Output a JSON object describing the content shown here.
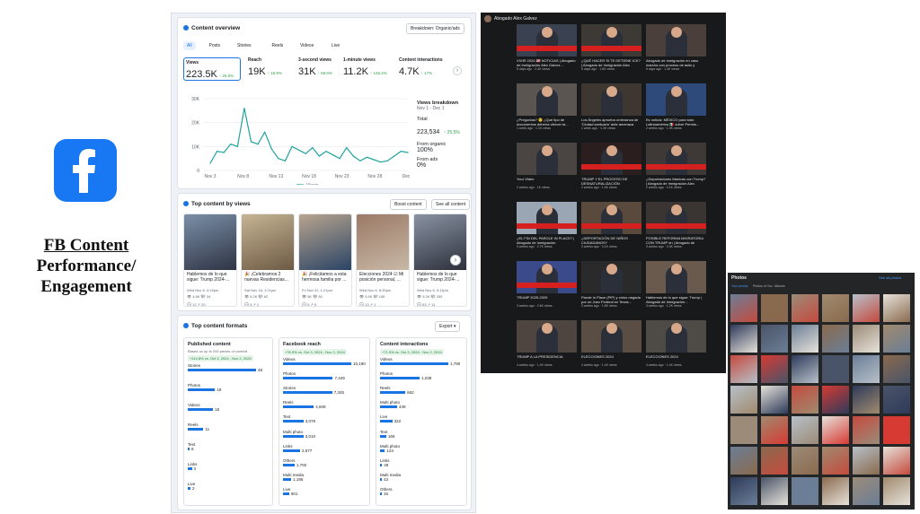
{
  "brand": {
    "title_line1": "FB Content",
    "title_line2": "Performance/",
    "title_line3": "Engagement",
    "accent": "#1877f2"
  },
  "overview": {
    "title": "Content overview",
    "breakdown_select": "Breakdown: Organic/ads",
    "tabs": [
      "All",
      "Posts",
      "Stories",
      "Reels",
      "Videos",
      "Live"
    ],
    "metrics": [
      {
        "label": "Views",
        "value": "223.5K",
        "change": "↑ 25.5%"
      },
      {
        "label": "Reach",
        "value": "19K",
        "change": "↑ 16.9%"
      },
      {
        "label": "3-second views",
        "value": "31K",
        "change": "↑ 68.6%"
      },
      {
        "label": "1-minute views",
        "value": "11.2K",
        "change": "↑ 145.4%"
      },
      {
        "label": "Content interactions",
        "value": "4.7K",
        "change": "↑ 17%"
      }
    ],
    "breakdown": {
      "title": "Views breakdown",
      "range": "Nov 1 - Dec 1",
      "total_label": "Total",
      "total_value": "223,534",
      "total_change": "↑ 25.5%",
      "organic_label": "From organic",
      "organic_value": "100%",
      "ads_label": "From ads",
      "ads_value": "0%"
    },
    "legend": "Views"
  },
  "chart_data": {
    "type": "line",
    "x_ticks": [
      "Nov 3",
      "Nov 8",
      "Nov 13",
      "Nov 18",
      "Nov 23",
      "Nov 28",
      "Dec 3"
    ],
    "y_ticks": [
      "30K",
      "20K",
      "10K",
      "0"
    ],
    "ylim": [
      0,
      30000
    ],
    "series": [
      {
        "name": "Views",
        "values": [
          3000,
          8000,
          7500,
          11000,
          10000,
          26000,
          12000,
          11000,
          16000,
          9000,
          5000,
          4000,
          10000,
          8500,
          7000,
          9500,
          6000,
          8000,
          6500,
          5000,
          9500,
          6000,
          4000,
          5500,
          4500,
          3500,
          4000,
          6000,
          8000,
          7500
        ]
      }
    ]
  },
  "top_content": {
    "title": "Top content by views",
    "boost_label": "Boost content",
    "see_all_label": "See all content",
    "posts": [
      {
        "caption": "Hablemos de lo que sigue: Trump 2024-...",
        "date": "Wed Nov 6, 4:15pm",
        "stats1": "👁 4.8K  ❤ 34",
        "stats2": "💬 12  ↗ 20"
      },
      {
        "caption": "🎉 ¡Celebramos 2 nuevas Residencias...",
        "date": "Sat Nov 16, 1:21pm",
        "stats1": "👁 6.2K  ❤ 62",
        "stats2": "💬 4  ↗ 1"
      },
      {
        "caption": "🎉 ¡Felicitamos a esta hermosa familia por ...",
        "date": "Fri Nov 22, 1:21pm",
        "stats1": "👁 6K  ❤ 80",
        "stats2": "💬 9  ↗ 0"
      },
      {
        "caption": "Elecciones 2024 ☑ Mi posición personal, ...",
        "date": "Wed Nov 6, 8:30pm",
        "stats1": "👁 5.5K  ❤ 106",
        "stats2": "💬 13  ↗ 1"
      },
      {
        "caption": "Hablemos de lo que sigue: Trump 2024-...",
        "date": "Wed Nov 6, 4:11pm",
        "stats1": "👁 5.2K  ❤ 259",
        "stats2": "💬 63  ↗ 11"
      }
    ]
  },
  "formats": {
    "title": "Top content formats",
    "export_label": "Export",
    "published": {
      "title": "Published content",
      "sub": "Based on up to 200 pieces of content",
      "change": "+114.8% vs. Oct 3, 2024 - Nov 2, 2024",
      "items": [
        {
          "label": "Stories",
          "value": "48",
          "frac": 1.0
        },
        {
          "label": "Photos",
          "value": "19",
          "frac": 0.4
        },
        {
          "label": "Videos",
          "value": "18",
          "frac": 0.37
        },
        {
          "label": "Reels",
          "value": "11",
          "frac": 0.23
        },
        {
          "label": "Text",
          "value": "8",
          "frac": 0.02
        },
        {
          "label": "Links",
          "value": "3",
          "frac": 0.06
        },
        {
          "label": "Live",
          "value": "2",
          "frac": 0.04
        }
      ]
    },
    "reach": {
      "title": "Facebook reach",
      "change": "+76.9% vs. Oct 3, 2024 - Nov 2, 2024",
      "items": [
        {
          "label": "Videos",
          "value": "10,190",
          "frac": 1.0
        },
        {
          "label": "Photos",
          "value": "7,449",
          "frac": 0.73
        },
        {
          "label": "Stories",
          "value": "7,345",
          "frac": 0.72
        },
        {
          "label": "Reels",
          "value": "4,609",
          "frac": 0.45
        },
        {
          "label": "Text",
          "value": "3,078",
          "frac": 0.3
        },
        {
          "label": "Multi photo",
          "value": "3,010",
          "frac": 0.3
        },
        {
          "label": "Links",
          "value": "2,577",
          "frac": 0.25
        },
        {
          "label": "Others",
          "value": "1,700",
          "frac": 0.17
        },
        {
          "label": "Multi media",
          "value": "1,195",
          "frac": 0.12
        },
        {
          "label": "Live",
          "value": "901",
          "frac": 0.09
        }
      ]
    },
    "interactions": {
      "title": "Content interactions",
      "change": "+71.5% vs. Oct 3, 2024 - Nov 2, 2024",
      "items": [
        {
          "label": "Videos",
          "value": "1,790",
          "frac": 1.0
        },
        {
          "label": "Photos",
          "value": "1,038",
          "frac": 0.58
        },
        {
          "label": "Reels",
          "value": "662",
          "frac": 0.37
        },
        {
          "label": "Multi photo",
          "value": "449",
          "frac": 0.25
        },
        {
          "label": "Live",
          "value": "322",
          "frac": 0.18
        },
        {
          "label": "Text",
          "value": "166",
          "frac": 0.09
        },
        {
          "label": "Multi photo",
          "value": "123",
          "frac": 0.07
        },
        {
          "label": "Links",
          "value": "48",
          "frac": 0.03
        },
        {
          "label": "Multi media",
          "value": "43",
          "frac": 0.02
        },
        {
          "label": "Others",
          "value": "15",
          "frac": 0.01
        }
      ]
    }
  },
  "videos_panel": {
    "channel": "Abogado Alex Galvez",
    "videos": [
      {
        "caption": "VIVIR 2024 🇺🇸 NOTICIAS | Abogado de Inmigración Alex Galvez...",
        "meta": "5 days ago · 2.4K views"
      },
      {
        "caption": "¿QUÉ HACER SI TE DETIENE ICE? | Abogado de Inmigración Alex Galvez...",
        "meta": "5 days ago · 1.6K views"
      },
      {
        "caption": "Abogado de inmigración en caso marcha con proceso de asilo y cómo...",
        "meta": "5 days ago · 1.4K views"
      },
      {
        "caption": "¿Preguntas? 🧐 ¿Qué tipo de documentos debería ofrecer la...",
        "meta": "1 week ago · 1.1K views"
      },
      {
        "caption": "Los Ángeles aprueba ordenanza de 'Ciudad santuario' ante amenaza de...",
        "meta": "1 week ago · 1.3K views"
      },
      {
        "caption": "Es noticia: MÉXICO para todo Latinoamérica 🇲🇽 sobre Permis...",
        "meta": "2 weeks ago · 1.3K views"
      },
      {
        "caption": "Your Video",
        "meta": "2 weeks ago · 1K views"
      },
      {
        "caption": "TRUMP Y EL PROCESO DE DESNATURALIZACIÓN",
        "meta": "2 weeks ago · 1.6K views"
      },
      {
        "caption": "¿Deportaciones Masivas con Trump? | Abogado de Inmigración Alex Galvez",
        "meta": "2 weeks ago · 4.1K views"
      },
      {
        "caption": "¿EL FIN DEL PAROLE IN PLACE? | Abogado de Inmigración",
        "meta": "3 weeks ago · 2.7K views"
      },
      {
        "caption": "¿DEPORTACIÓN DE NIÑOS CIUDADANOS?",
        "meta": "3 weeks ago · 3.1K views"
      },
      {
        "caption": "POSIBLE REFORMA MIGRATORIA CON TRUMP en | Abogado de Inmigración...",
        "meta": "3 weeks ago · 3.3K views"
      },
      {
        "caption": "TRUMP 2025-2029",
        "meta": "3 weeks ago · 2.6K views"
      },
      {
        "caption": "Parole In Place (PIP) y cómo negada por un Juez Federal en Texas...",
        "meta": "3 weeks ago · 1.8K views"
      },
      {
        "caption": "Hablemos de lo que sigue: Trump | Abogado de Inmigración...",
        "meta": "3 weeks ago · 1.2K views"
      },
      {
        "caption": "TRUMP A LA PRESIDENCIA",
        "meta": "4 weeks ago · 1.4K views"
      },
      {
        "caption": "ELECCIONES 2024",
        "meta": "4 weeks ago · 1.4K views"
      },
      {
        "caption": "ELECCIONES 2024",
        "meta": "4 weeks ago · 1.4K views"
      }
    ]
  },
  "photos_panel": {
    "title": "Photos",
    "tabs": [
      "Your photos",
      "Photos of You",
      "Albums"
    ],
    "link": "See all photos"
  }
}
